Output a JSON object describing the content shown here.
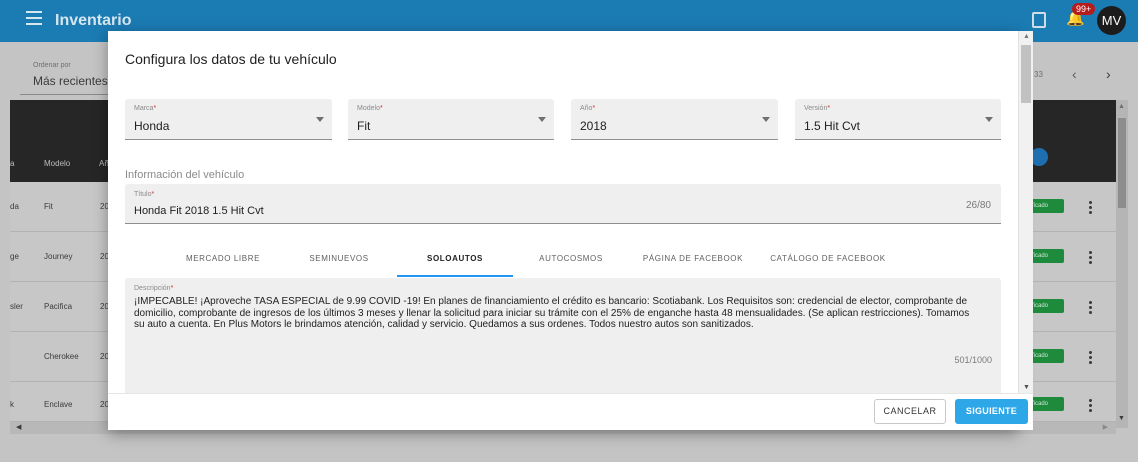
{
  "app": {
    "title": "Inventario",
    "notification_badge": "99+",
    "avatar_initials": "MV"
  },
  "background": {
    "order_by_label": "Ordenar por",
    "order_by_value": "Más recientes",
    "pager_text": "33",
    "columns": [
      "a",
      "Modelo",
      "Añ"
    ],
    "rows": [
      {
        "brand": "da",
        "model": "Fit",
        "year": "20",
        "status": "ficado"
      },
      {
        "brand": "ge",
        "model": "Journey",
        "year": "20",
        "status": "ficado"
      },
      {
        "brand": "sler",
        "model": "Pacifica",
        "year": "20",
        "status": "ficado"
      },
      {
        "brand": "",
        "model": "Cherokee",
        "year": "20",
        "status": "ficado"
      },
      {
        "brand": "k",
        "model": "Enclave",
        "year": "20",
        "status": "ficado"
      }
    ]
  },
  "modal": {
    "title": "Configura los datos de tu vehículo",
    "fields": {
      "marca": {
        "label": "Marca",
        "value": "Honda"
      },
      "modelo": {
        "label": "Modelo",
        "value": "Fit"
      },
      "anio": {
        "label": "Año",
        "value": "2018"
      },
      "version": {
        "label": "Versión",
        "value": "1.5 Hit Cvt"
      }
    },
    "section_label": "Información del vehículo",
    "titulo": {
      "label": "Título",
      "value": "Honda Fit 2018 1.5 Hit Cvt",
      "counter": "26/80"
    },
    "tabs": [
      "MERCADO LIBRE",
      "SEMINUEVOS",
      "SOLOAUTOS",
      "AUTOCOSMOS",
      "PÁGINA DE FACEBOOK",
      "CATÁLOGO DE FACEBOOK"
    ],
    "active_tab": "SOLOAUTOS",
    "descripcion": {
      "label": "Descripción",
      "value": "¡IMPECABLE! ¡Aproveche TASA ESPECIAL de 9.99 COVID -19! En planes de financiamiento el crédito es bancario: Scotiabank. Los Requisitos son: credencial de elector, comprobante de domicilio, comprobante de ingresos de los últimos 3 meses y llenar la solicitud para iniciar su trámite con el 25% de enganche hasta 48 mensualidades. (Se aplican restricciones). Tomamos su auto a cuenta. En Plus Motors le brindamos atención, calidad y servicio. Quedamos a sus ordenes. Todos nuestro autos son sanitizados.",
      "counter": "501/1000"
    },
    "cancel_label": "CANCELAR",
    "next_label": "SIGUIENTE"
  },
  "colors": {
    "appbar": "#1b7bb3",
    "accent": "#2196f3",
    "primary_button": "#2ea7e8",
    "required_marker": "#d32f2f",
    "published_badge": "#1e8a3c"
  },
  "icons": [
    "menu-icon",
    "inbox-icon",
    "bell-icon",
    "chevron-left-icon",
    "chevron-right-icon",
    "dropdown-arrow-icon",
    "kebab-menu-icon"
  ]
}
